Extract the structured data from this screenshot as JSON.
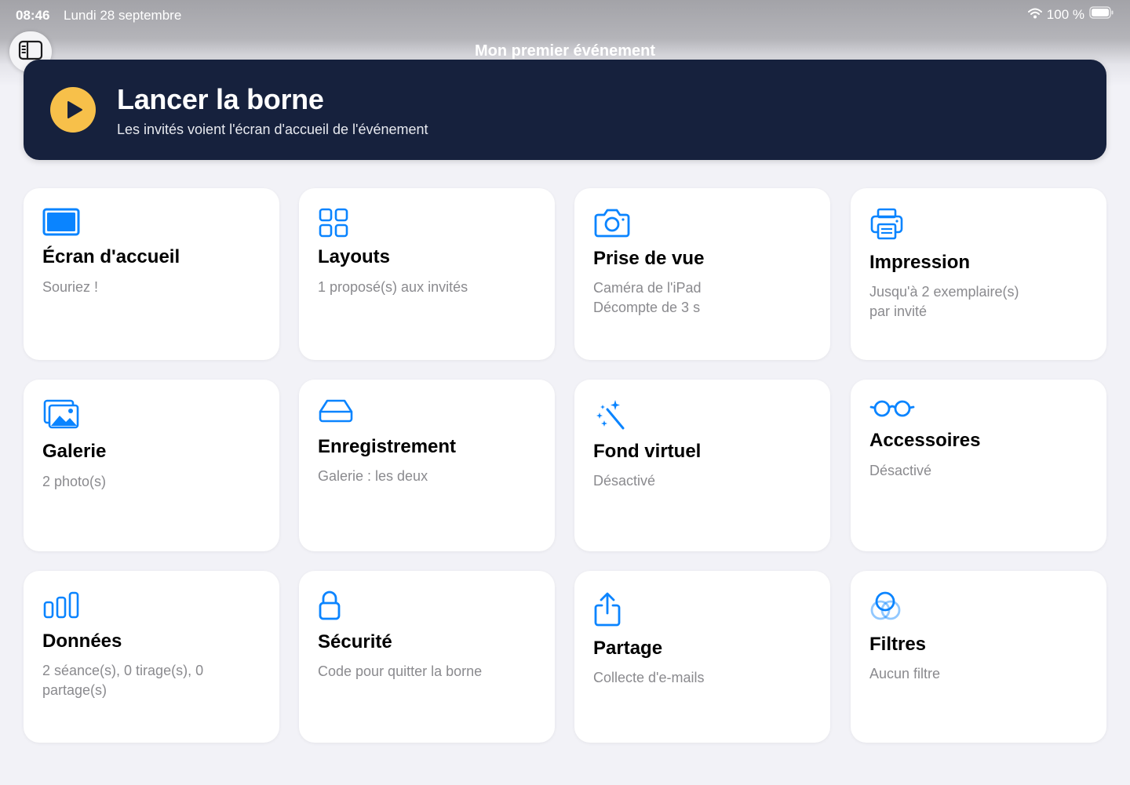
{
  "status_bar": {
    "time": "08:46",
    "date": "Lundi 28 septembre",
    "battery": "100 %"
  },
  "nav": {
    "title": "Mon premier événement"
  },
  "launch": {
    "title": "Lancer la borne",
    "subtitle": "Les invités voient l'écran d'accueil de l'événement",
    "accent": "#f7c04a",
    "background": "#16213d"
  },
  "accent_color": "#0a84ff",
  "cards": [
    {
      "icon": "display-icon",
      "title": "Écran d'accueil",
      "lines": [
        "Souriez !"
      ]
    },
    {
      "icon": "grid-icon",
      "title": "Layouts",
      "lines": [
        "1 proposé(s) aux invités"
      ]
    },
    {
      "icon": "camera-icon",
      "title": "Prise de vue",
      "lines": [
        "Caméra de l'iPad",
        "Décompte de 3 s"
      ]
    },
    {
      "icon": "printer-icon",
      "title": "Impression",
      "lines": [
        "Jusqu'à 2 exemplaire(s)",
        "par invité"
      ]
    },
    {
      "icon": "photos-icon",
      "title": "Galerie",
      "lines": [
        "2 photo(s)"
      ]
    },
    {
      "icon": "drive-icon",
      "title": "Enregistrement",
      "lines": [
        "Galerie : les deux"
      ]
    },
    {
      "icon": "magic-wand-icon",
      "title": "Fond virtuel",
      "lines": [
        "Désactivé"
      ]
    },
    {
      "icon": "glasses-icon",
      "title": "Accessoires",
      "lines": [
        "Désactivé"
      ]
    },
    {
      "icon": "chart-bars-icon",
      "title": "Données",
      "lines": [
        "2 séance(s), 0 tirage(s), 0",
        "partage(s)"
      ]
    },
    {
      "icon": "lock-icon",
      "title": "Sécurité",
      "lines": [
        "Code pour quitter la borne"
      ]
    },
    {
      "icon": "share-icon",
      "title": "Partage",
      "lines": [
        "Collecte d'e-mails"
      ]
    },
    {
      "icon": "filters-icon",
      "title": "Filtres",
      "lines": [
        "Aucun filtre"
      ]
    }
  ]
}
